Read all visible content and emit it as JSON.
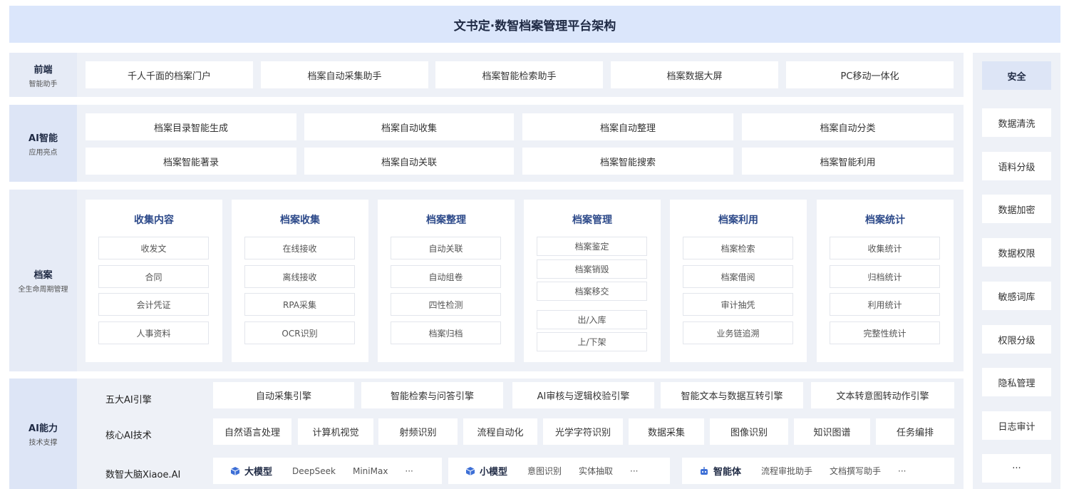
{
  "title": "文书定·数智档案管理平台架构",
  "frontend": {
    "label": "前端",
    "sublabel": "智能助手",
    "items": [
      "千人千面的档案门户",
      "档案自动采集助手",
      "档案智能检索助手",
      "档案数据大屏",
      "PC移动一体化"
    ]
  },
  "ai_smart": {
    "label": "AI智能",
    "sublabel": "应用亮点",
    "row1": [
      "档案目录智能生成",
      "档案自动收集",
      "档案自动整理",
      "档案自动分类"
    ],
    "row2": [
      "档案智能著录",
      "档案自动关联",
      "档案智能搜索",
      "档案智能利用"
    ]
  },
  "archive": {
    "label": "档案",
    "sublabel": "全生命周期管理",
    "panels": [
      {
        "title": "收集内容",
        "items": [
          "收发文",
          "合同",
          "会计凭证",
          "人事资料"
        ]
      },
      {
        "title": "档案收集",
        "items": [
          "在线接收",
          "离线接收",
          "RPA采集",
          "OCR识别"
        ]
      },
      {
        "title": "档案整理",
        "items": [
          "自动关联",
          "自动组卷",
          "四性检测",
          "档案归档"
        ]
      },
      {
        "title": "档案管理",
        "items": [
          "档案鉴定",
          "档案销毁",
          "档案移交",
          "出/入库",
          "上/下架"
        ]
      },
      {
        "title": "档案利用",
        "items": [
          "档案检索",
          "档案借阅",
          "审计抽凭",
          "业务链追溯"
        ]
      },
      {
        "title": "档案统计",
        "items": [
          "收集统计",
          "归档统计",
          "利用统计",
          "完整性统计"
        ]
      }
    ]
  },
  "ai_ability": {
    "label": "AI能力",
    "sublabel": "技术支撑",
    "engines_label": "五大AI引擎",
    "engines": [
      "自动采集引擎",
      "智能检索与问答引擎",
      "AI审核与逻辑校验引擎",
      "智能文本与数据互转引擎",
      "文本转意图转动作引擎"
    ],
    "core_label": "核心AI技术",
    "core": [
      "自然语言处理",
      "计算机视觉",
      "射频识别",
      "流程自动化",
      "光学字符识别",
      "数据采集",
      "图像识别",
      "知识图谱",
      "任务编排"
    ],
    "brain_label": "数智大脑Xiaoe.AI",
    "big_model": {
      "head": "大模型",
      "items": [
        "DeepSeek",
        "MiniMax",
        "···"
      ]
    },
    "small_model": {
      "head": "小模型",
      "items": [
        "意图识别",
        "实体抽取",
        "···"
      ]
    },
    "agent": {
      "head": "智能体",
      "items": [
        "流程审批助手",
        "文档撰写助手",
        "···"
      ]
    }
  },
  "security": {
    "head": "安全",
    "items": [
      "数据清洗",
      "语料分级",
      "数据加密",
      "数据权限",
      "敏感词库",
      "权限分级",
      "隐私管理",
      "日志审计",
      "···"
    ]
  },
  "colors": {
    "title_bg": "#dbe6fb",
    "layer_bg": "#eef1f7",
    "label_bg": "#e6ebf6",
    "accent": "#2d4a8a",
    "icon": "#3d6fd6"
  }
}
